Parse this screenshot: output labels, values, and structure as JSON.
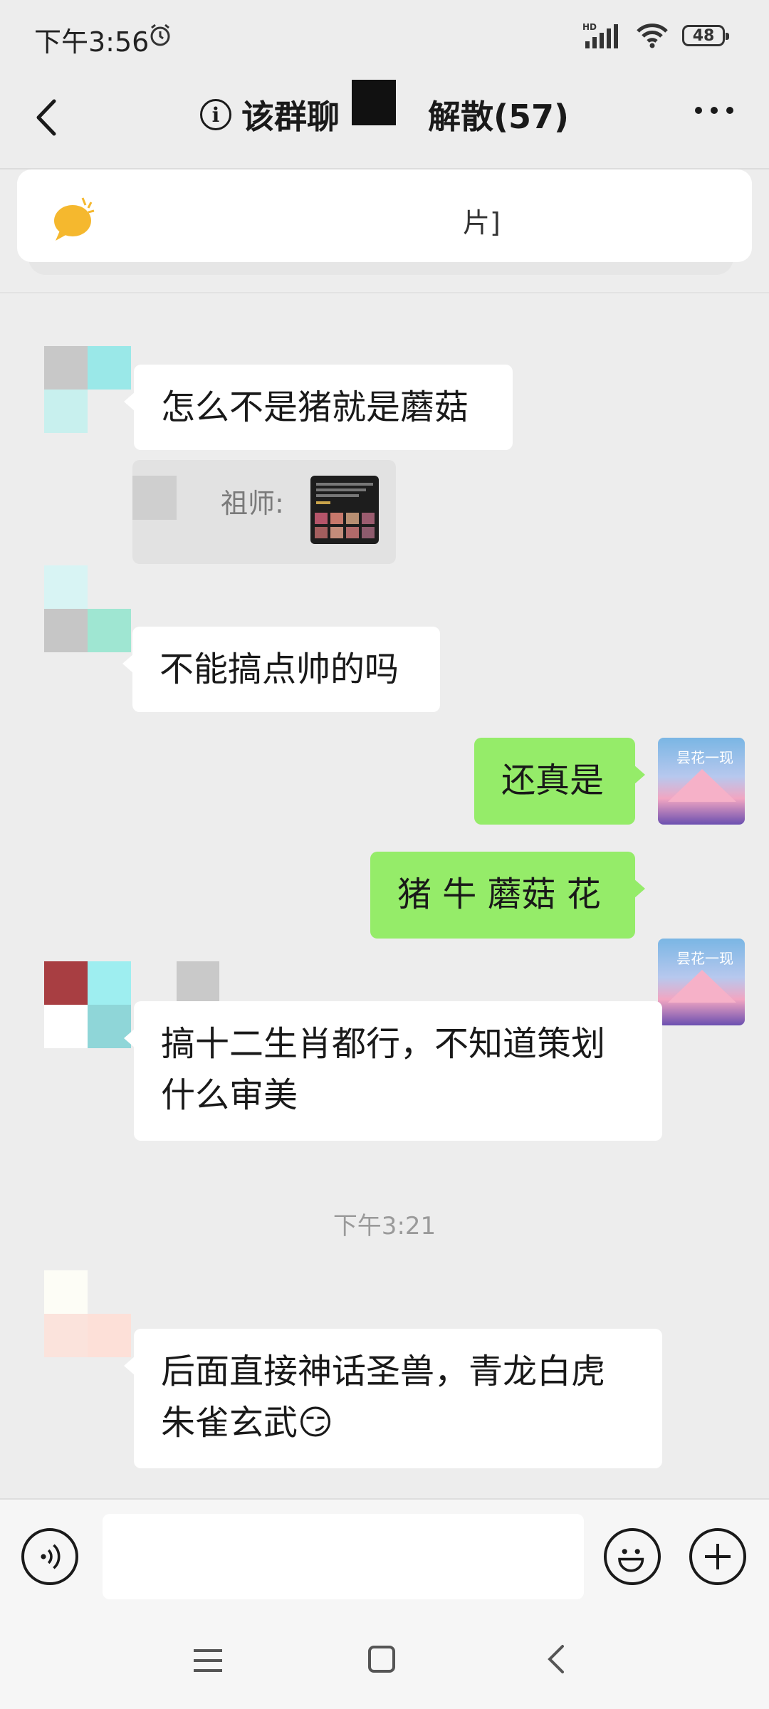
{
  "status_bar": {
    "time": "下午3:56",
    "hd": "HD",
    "battery": "48"
  },
  "header": {
    "info_symbol": "i",
    "title_left": "该群聊",
    "title_right": "解散(57)"
  },
  "notice": {
    "text": "片]"
  },
  "messages": [
    {
      "side": "left",
      "text": "怎么不是猪就是蘑菇"
    },
    {
      "side": "left",
      "quote_prefix": "祖师:"
    },
    {
      "side": "left",
      "text": "不能搞点帅的吗"
    },
    {
      "side": "right",
      "text": "还真是"
    },
    {
      "side": "right",
      "text": "猪 牛 蘑菇 花"
    },
    {
      "side": "left",
      "text": "搞十二生肖都行，不知道策划什么审美"
    },
    {
      "side": "left",
      "text": "后面直接神话圣兽，青龙白虎朱雀玄武😏"
    }
  ],
  "time_separator": "下午3:21",
  "self_avatar_text": "昙花一现",
  "input": {
    "value": "",
    "placeholder": ""
  },
  "icons": {
    "back": "chevron-left-icon",
    "more": "more-dots-icon",
    "voice": "voice-icon",
    "emoji": "emoji-icon",
    "plus": "plus-icon",
    "notice": "notice-bubble-icon"
  },
  "colors": {
    "bg": "#ededed",
    "self_bubble": "#95ec69",
    "other_bubble": "#ffffff"
  }
}
